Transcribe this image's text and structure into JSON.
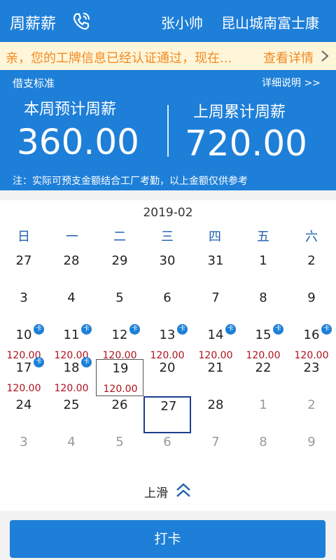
{
  "header": {
    "title": "周薪薪",
    "user": "张小帅",
    "factory": "昆山城南富士康",
    "icons": {
      "phone": "phone-icon"
    }
  },
  "notice": {
    "message": "亲，您的工牌信息已经认证通过，现在...",
    "link": "查看详情"
  },
  "summary": {
    "standard_label": "借支标准",
    "detail_link": "详细说明 >>",
    "this_week_label": "本周预计周薪",
    "this_week_value": "360.00",
    "last_week_label": "上周累计周薪",
    "last_week_value": "720.00",
    "note": "注：实际可预支金额结合工厂考勤，以上金额仅供参考"
  },
  "calendar": {
    "month": "2019-02",
    "weekdays": [
      "日",
      "一",
      "二",
      "三",
      "四",
      "五",
      "六"
    ],
    "badge": "卡",
    "days": [
      {
        "d": "27",
        "dim": false
      },
      {
        "d": "28",
        "dim": false
      },
      {
        "d": "29",
        "dim": false
      },
      {
        "d": "30",
        "dim": false
      },
      {
        "d": "31",
        "dim": false
      },
      {
        "d": "1",
        "dim": false
      },
      {
        "d": "2",
        "dim": false
      },
      {
        "d": "3"
      },
      {
        "d": "4"
      },
      {
        "d": "5"
      },
      {
        "d": "6"
      },
      {
        "d": "7"
      },
      {
        "d": "8"
      },
      {
        "d": "9"
      },
      {
        "d": "10",
        "amt": "120.00",
        "card": true
      },
      {
        "d": "11",
        "amt": "120.00",
        "card": true
      },
      {
        "d": "12",
        "amt": "120.00",
        "card": true
      },
      {
        "d": "13",
        "amt": "120.00",
        "card": true
      },
      {
        "d": "14",
        "amt": "120.00",
        "card": true
      },
      {
        "d": "15",
        "amt": "120.00",
        "card": true
      },
      {
        "d": "16",
        "amt": "120.00",
        "card": true
      },
      {
        "d": "17",
        "amt": "120.00",
        "card": true
      },
      {
        "d": "18",
        "amt": "120.00",
        "card": true
      },
      {
        "d": "19",
        "amt": "120.00",
        "boxed": true
      },
      {
        "d": "20"
      },
      {
        "d": "21"
      },
      {
        "d": "22"
      },
      {
        "d": "23"
      },
      {
        "d": "24"
      },
      {
        "d": "25"
      },
      {
        "d": "26"
      },
      {
        "d": "27",
        "today": true
      },
      {
        "d": "28"
      },
      {
        "d": "1",
        "dim": true
      },
      {
        "d": "2",
        "dim": true
      },
      {
        "d": "3",
        "dim": true
      },
      {
        "d": "4",
        "dim": true
      },
      {
        "d": "5",
        "dim": true
      },
      {
        "d": "6",
        "dim": true
      },
      {
        "d": "7",
        "dim": true
      },
      {
        "d": "8",
        "dim": true
      },
      {
        "d": "9",
        "dim": true
      }
    ]
  },
  "swipe": {
    "label": "上滑",
    "icon": "double-chevron-up-icon"
  },
  "punch_button": "打卡",
  "colors": {
    "primary": "#1e7fd8",
    "notice_text": "#f08a24",
    "amount": "#b0101c"
  }
}
